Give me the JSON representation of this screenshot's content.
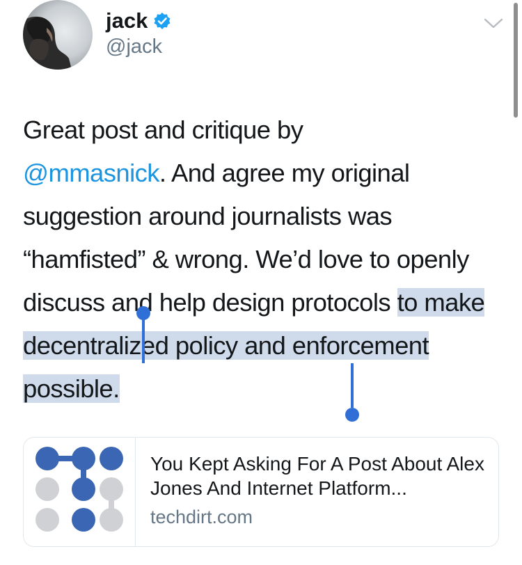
{
  "header": {
    "name": "jack",
    "handle": "@jack",
    "verified": true
  },
  "tweet": {
    "text_before_mention": "Great post and critique by",
    "mention": "@mmasnick",
    "text_after_mention": ". And agree my original suggestion around journalists was “hamfisted” & wrong. We’d love to openly discuss and help design protocols ",
    "selected_text": "to make decentralized policy and enforcement possible."
  },
  "link_card": {
    "title": "You Kept Asking For A Post About Alex Jones And Internet Platform...",
    "domain": "techdirt.com",
    "thumbnail_icon": "techdirt-logo-icon"
  },
  "colors": {
    "mention": "#1b95e0",
    "selection_highlight": "#cfdbeb",
    "selection_handle": "#2f6fd6",
    "secondary_text": "#657786",
    "verified_badge": "#1da1f2",
    "logo_blue": "#3a66b3",
    "logo_gray": "#cfd1d4"
  }
}
